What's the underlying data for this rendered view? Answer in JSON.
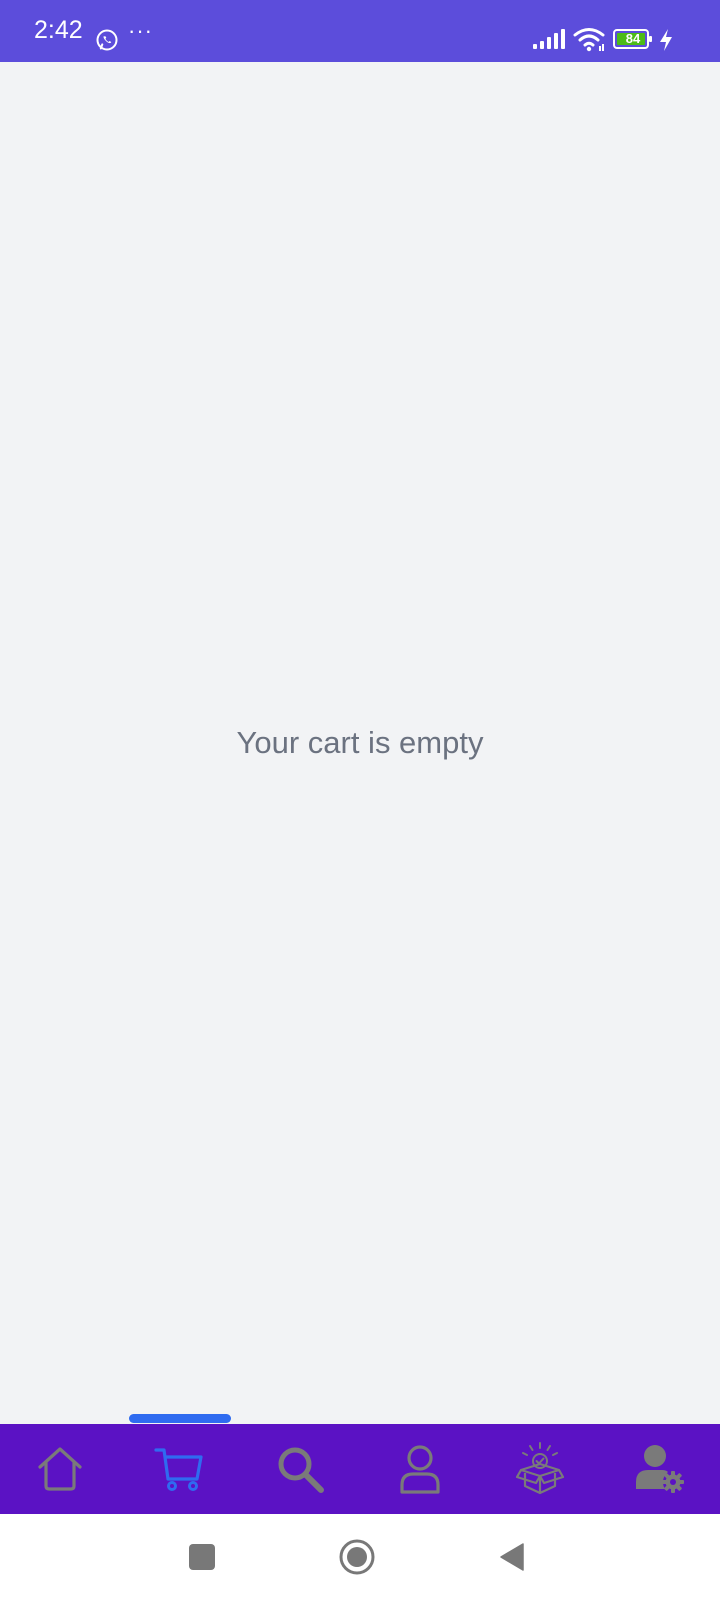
{
  "status_bar": {
    "time": "2:42",
    "more": "···",
    "battery_level": "84",
    "icons": [
      "whatsapp-icon",
      "more-dots-icon",
      "signal-icon",
      "wifi-icon",
      "battery-icon",
      "charging-icon"
    ]
  },
  "main": {
    "empty_message": "Your cart is empty"
  },
  "bottom_nav": {
    "active_index": 1,
    "items": [
      {
        "name": "home",
        "icon": "home-icon"
      },
      {
        "name": "cart",
        "icon": "cart-icon"
      },
      {
        "name": "search",
        "icon": "search-icon"
      },
      {
        "name": "profile",
        "icon": "user-icon"
      },
      {
        "name": "orders",
        "icon": "box-icon"
      },
      {
        "name": "account-settings",
        "icon": "user-settings-icon"
      }
    ]
  },
  "system_nav": {
    "items": [
      "recent-apps-icon",
      "home-button-icon",
      "back-icon"
    ]
  },
  "colors": {
    "status_bar": "#5c4ddb",
    "background": "#f2f3f5",
    "empty_text": "#6b7280",
    "bottom_nav_bg": "#5b12c4",
    "active_icon": "#2f6bf0",
    "inactive_icon": "#7a7a7a",
    "battery_fill": "#4cbb17"
  }
}
